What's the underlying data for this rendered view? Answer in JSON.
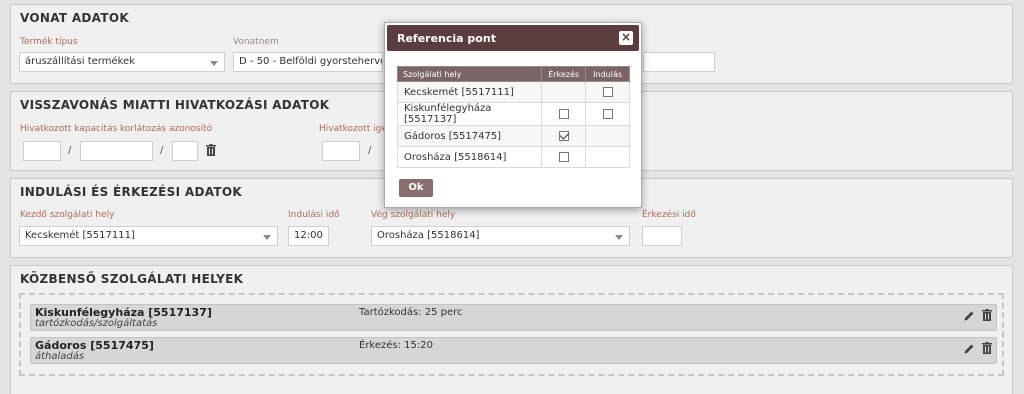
{
  "vonat": {
    "title": "VONAT ADATOK",
    "termek_label": "Termék típus",
    "termek_value": "áruszállítási termékek",
    "vonatnem_label": "Vonatnem",
    "vonatnem_value": "D - 50 - Belföldi gyorstehervona"
  },
  "visszavonas": {
    "title": "VISSZAVONÁS MIATTI HIVATKOZÁSI ADATOK",
    "kap_label": "Hivatkozott kapacitás korlátozás azonosító",
    "ig_label": "Hivatkozott igé",
    "sep": "/"
  },
  "indulasi": {
    "title": "INDULÁSI ÉS ÉRKEZÉSI ADATOK",
    "kezdo_label": "Kezdő szolgálati hely",
    "kezdo_value": "Kecskemét [5517111]",
    "indulasi_ido_label": "Indulási idő",
    "indulasi_ido_value": "12:00",
    "veg_label": "Vég szolgálati hely",
    "veg_value": "Orosháza [5518614]",
    "erkezesi_ido_label": "Érkezési idő",
    "erkezesi_ido_value": ""
  },
  "kozbenso": {
    "title": "KÖZBENSŐ SZOLGÁLATI HELYEK",
    "stops": [
      {
        "name": "Kiskunfélegyháza [5517137]",
        "sub": "tartózkodás/szolgáltatás",
        "info": "Tartózkodás: 25 perc"
      },
      {
        "name": "Gádoros [5517475]",
        "sub": "áthaladás",
        "info": "Érkezés: 15:20"
      }
    ]
  },
  "modal": {
    "title": "Referencia pont",
    "close": "×",
    "col_hely": "Szolgálati hely",
    "col_erkezes": "Érkezés",
    "col_indulas": "Indulás",
    "rows": [
      {
        "hely": "Kecskemét [5517111]",
        "erkezes": null,
        "indulas": false
      },
      {
        "hely": "Kiskunfélegyháza [5517137]",
        "erkezes": false,
        "indulas": false
      },
      {
        "hely": "Gádoros [5517475]",
        "erkezes": true,
        "indulas": null
      },
      {
        "hely": "Orosháza [5518614]",
        "erkezes": false,
        "indulas": null
      }
    ],
    "ok": "Ok"
  },
  "colors": {
    "accent": "#5b3d3f",
    "label": "#b06a5a",
    "table_header": "#7a6465",
    "button": "#8a6e6e"
  },
  "icons": [
    "trash-icon",
    "pencil-icon",
    "close-icon",
    "chevron-down-icon"
  ]
}
